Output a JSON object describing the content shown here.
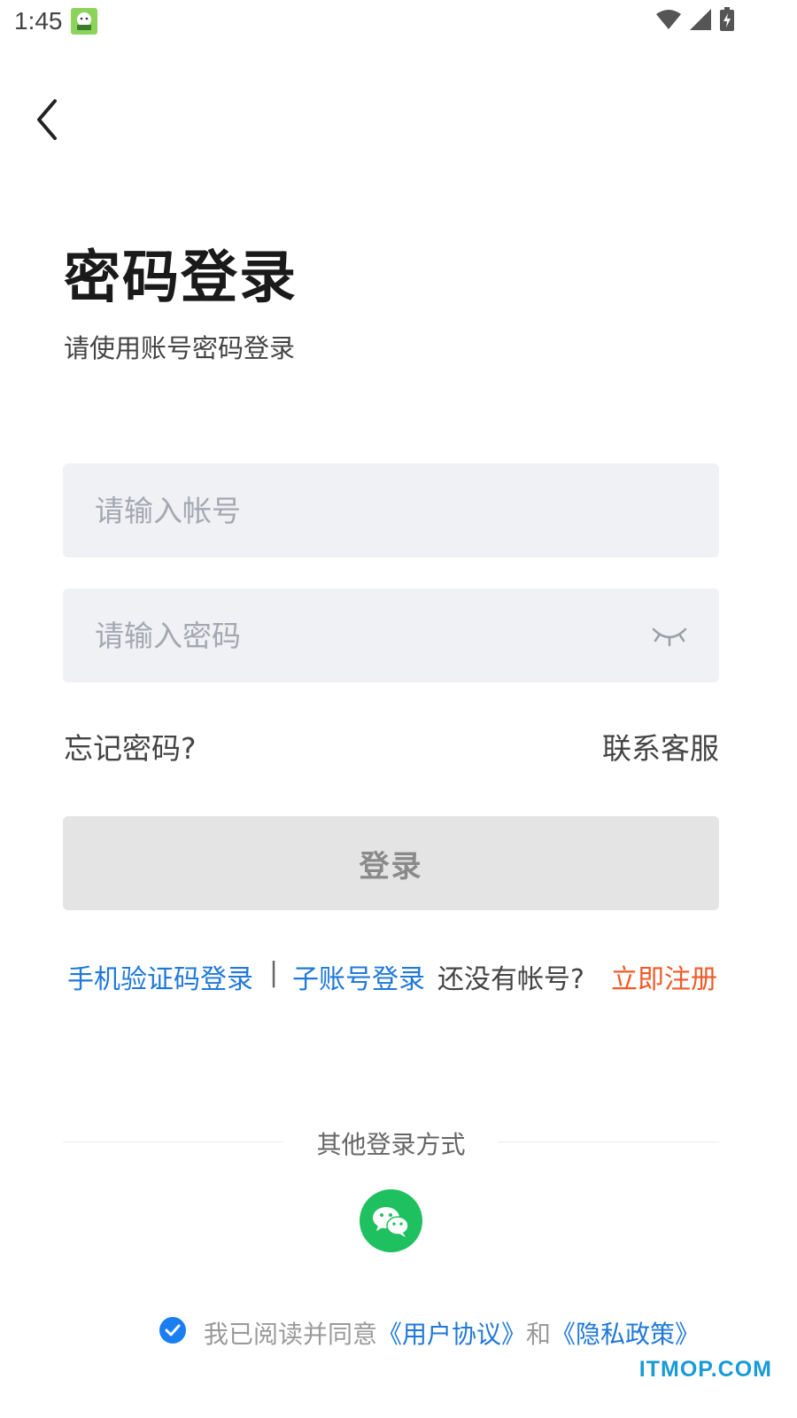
{
  "status_bar": {
    "time": "1:45",
    "icons": [
      "app-notification-icon",
      "wifi-icon",
      "signal-icon",
      "battery-charging-icon"
    ]
  },
  "nav": {
    "back_icon": "chevron-left-icon"
  },
  "header": {
    "title": "密码登录",
    "subtitle": "请使用账号密码登录"
  },
  "form": {
    "account_placeholder": "请输入帐号",
    "account_value": "",
    "password_placeholder": "请输入密码",
    "password_value": "",
    "password_toggle_icon": "eye-closed-icon"
  },
  "links": {
    "forgot_password": "忘记密码?",
    "contact_service": "联系客服"
  },
  "login_button": {
    "label": "登录",
    "state": "disabled"
  },
  "alt_login": {
    "sms_login": "手机验证码登录",
    "separator": "|",
    "sub_account_login": "子账号登录",
    "no_account": "还没有帐号?",
    "register": "立即注册"
  },
  "other_login": {
    "label": "其他登录方式",
    "methods": [
      {
        "icon": "wechat-icon"
      }
    ]
  },
  "agreement": {
    "checked": true,
    "prefix": "我已阅读并同意",
    "user_agreement": "《用户协议》",
    "and": "和",
    "privacy_policy": "《隐私政策》"
  },
  "watermark": "ITMOP.COM",
  "colors": {
    "link_blue": "#2079d8",
    "register_orange": "#f05a28",
    "wechat_green": "#1fc05f",
    "check_blue": "#1a7ef0",
    "input_bg": "#f0f1f5",
    "button_disabled_bg": "#e4e4e4"
  }
}
